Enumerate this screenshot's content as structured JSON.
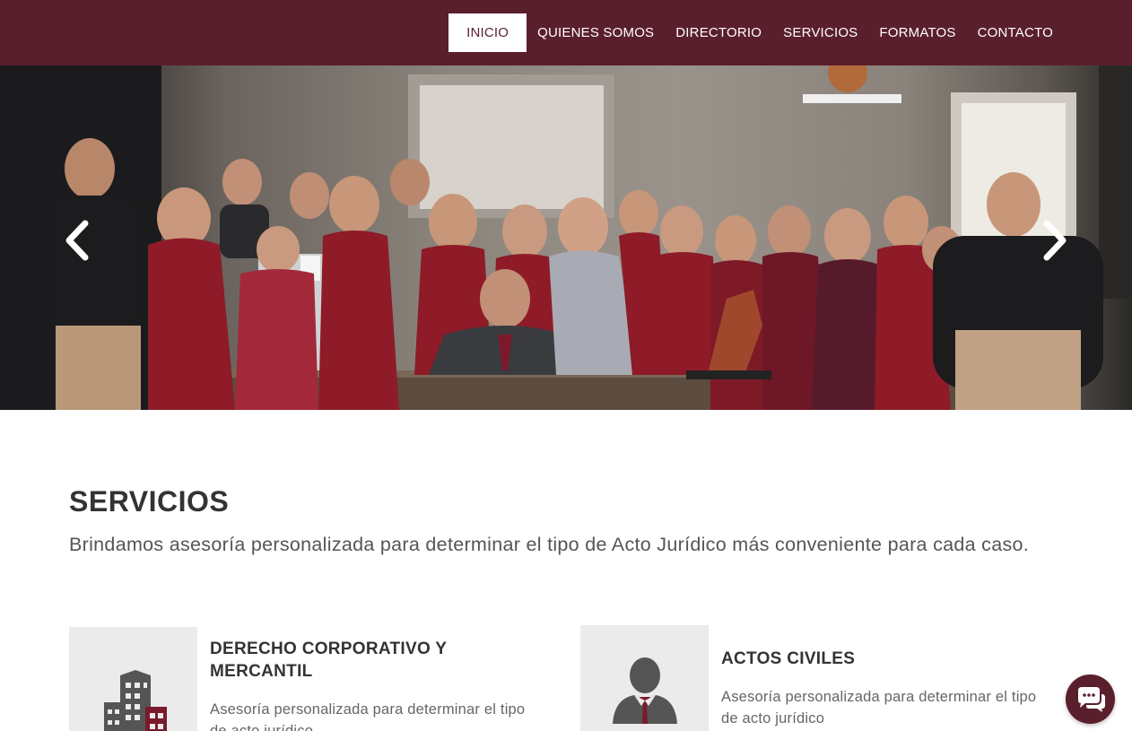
{
  "nav": {
    "items": [
      {
        "label": "INICIO",
        "active": true
      },
      {
        "label": "QUIENES SOMOS",
        "active": false
      },
      {
        "label": "DIRECTORIO",
        "active": false
      },
      {
        "label": "SERVICIOS",
        "active": false
      },
      {
        "label": "FORMATOS",
        "active": false
      },
      {
        "label": "CONTACTO",
        "active": false
      }
    ]
  },
  "hero": {
    "prev_icon": "chevron-left-icon",
    "next_icon": "chevron-right-icon"
  },
  "services": {
    "title": "SERVICIOS",
    "subtitle": "Brindamos asesoría personalizada para determinar el tipo de Acto Jurídico más conveniente para cada caso.",
    "cards": [
      {
        "title": "DERECHO CORPORATIVO Y MERCANTIL",
        "description": "Asesoría personalizada para determinar el tipo de acto jurídico",
        "icon": "building-icon"
      },
      {
        "title": "ACTOS CIVILES",
        "description": "Asesoría personalizada para determinar el tipo de acto jurídico",
        "icon": "person-icon"
      }
    ]
  },
  "chat": {
    "icon": "chat-icon"
  },
  "colors": {
    "brand": "#5a1f2d",
    "accent": "#8b1a2b",
    "text": "#333333"
  }
}
